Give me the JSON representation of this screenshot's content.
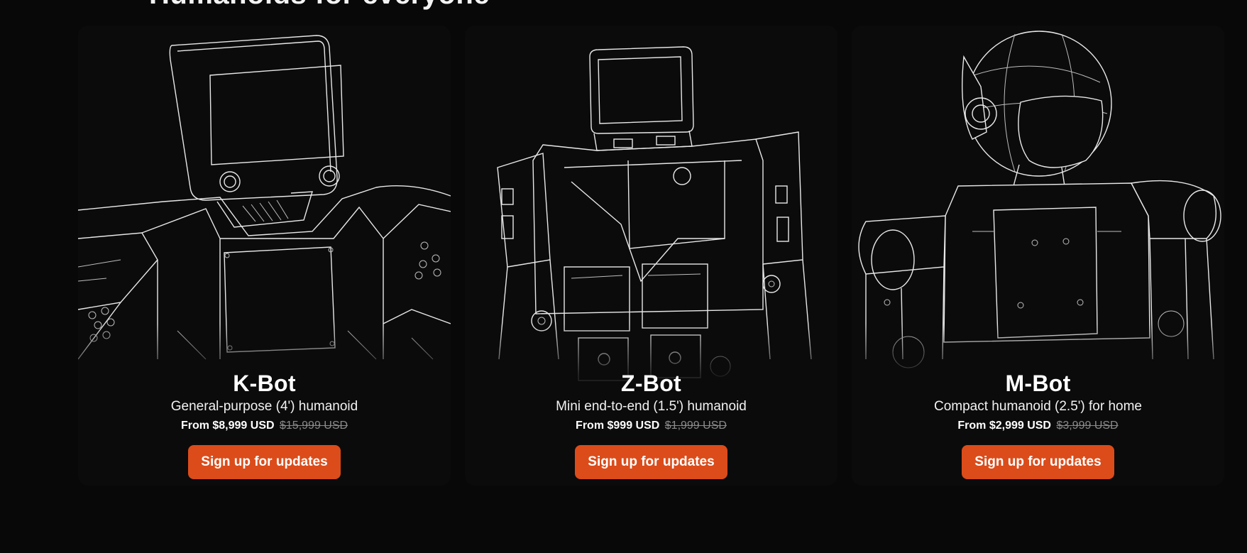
{
  "section": {
    "heading": "Humanoids for everyone"
  },
  "products": [
    {
      "name": "K-Bot",
      "description": "General-purpose (4') humanoid",
      "price_prefix": "From $8,999 USD",
      "price_original": "$15,999 USD",
      "cta": "Sign up for updates"
    },
    {
      "name": "Z-Bot",
      "description": "Mini end-to-end (1.5') humanoid",
      "price_prefix": "From $999 USD",
      "price_original": "$1,999 USD",
      "cta": "Sign up for updates"
    },
    {
      "name": "M-Bot",
      "description": "Compact humanoid (2.5') for home",
      "price_prefix": "From $2,999 USD",
      "price_original": "$3,999 USD",
      "cta": "Sign up for updates"
    }
  ],
  "colors": {
    "background": "#080808",
    "card": "#0b0b0b",
    "accent": "#db4c1a",
    "text": "#ffffff",
    "strike": "#8a8a8a"
  }
}
